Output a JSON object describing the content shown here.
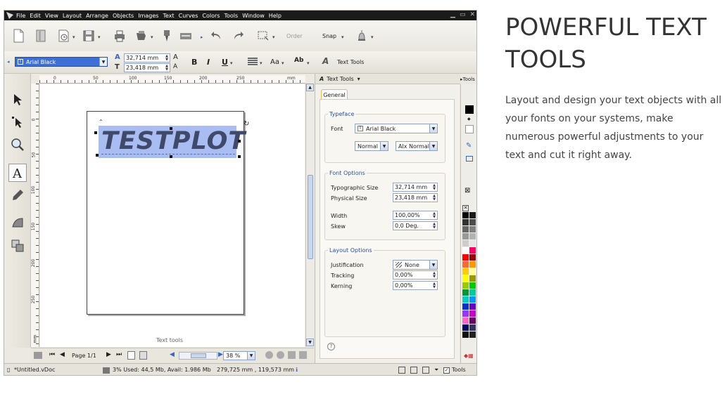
{
  "window": {
    "menu": [
      "File",
      "Edit",
      "View",
      "Layout",
      "Arrange",
      "Objects",
      "Images",
      "Text",
      "Curves",
      "Colors",
      "Tools",
      "Window",
      "Help"
    ]
  },
  "toolbar": {
    "order_label": "Order",
    "snap_label": "Snap"
  },
  "text_toolbar": {
    "font_name": "Arial Black",
    "typographic_size": "32,714 mm",
    "physical_size": "23,418 mm",
    "bold_label": "B",
    "italic_label": "I",
    "underline_label": "U",
    "case_label": "Aa",
    "text_tools_label": "Text Tools"
  },
  "ruler": {
    "top_ticks": [
      "0",
      "50",
      "100",
      "150",
      "200",
      "250",
      "mm"
    ],
    "left_ticks": [
      "0",
      "50",
      "100",
      "150",
      "200",
      "250",
      "mm"
    ]
  },
  "canvas": {
    "text_object": "TESTPLOT",
    "caption": "Text tools"
  },
  "navigation": {
    "page_label": "Page 1/1",
    "zoom": "38 %"
  },
  "status": {
    "document": "*Untitled.vDoc",
    "memory": "3%  Used: 44,5 Mb, Avail: 1.986 Mb",
    "coordinates": "279,725 mm , 119,573 mm",
    "tools_label": "Tools"
  },
  "docker": {
    "title": "Text Tools",
    "tools_tab": "Tools",
    "tab_general": "General",
    "typeface": {
      "group_title": "Typeface",
      "font_label": "Font",
      "font_value": "Arial Black",
      "style_value": "Normal",
      "alt_value": "Alx Normal"
    },
    "font_options": {
      "group_title": "Font Options",
      "typographic_size_label": "Typographic Size",
      "typographic_size_value": "32,714 mm",
      "physical_size_label": "Physical Size",
      "physical_size_value": "23,418 mm",
      "width_label": "Width",
      "width_value": "100,00%",
      "skew_label": "Skew",
      "skew_value": "0,0 Deg."
    },
    "layout_options": {
      "group_title": "Layout Options",
      "justification_label": "Justification",
      "justification_value": "None",
      "tracking_label": "Tracking",
      "tracking_value": "0,00%",
      "kerning_label": "Kerning",
      "kerning_value": "0,00%"
    },
    "help_icon_label": "?"
  },
  "palette": {
    "colors": [
      "#000000",
      "#1a1a1a",
      "#333333",
      "#4d4d4d",
      "#666666",
      "#808080",
      "#999999",
      "#b3b3b3",
      "#cccccc",
      "#e6e6e6",
      "#ffffff",
      "#ff0066",
      "#ff0000",
      "#990000",
      "#ff6633",
      "#ff9900",
      "#ffcc00",
      "#ffff99",
      "#ffff00",
      "#999900",
      "#99cc00",
      "#00cc00",
      "#009933",
      "#00cc99",
      "#00cccc",
      "#0099ff",
      "#0033cc",
      "#6600cc",
      "#9933ff",
      "#cc00cc",
      "#ff66cc",
      "#660066",
      "#000066",
      "#333366",
      "#111111",
      "#222222"
    ]
  },
  "marketing": {
    "title": "POWERFUL TEXT TOOLS",
    "description": "Layout and design your text objects with all your fonts on your systems, make numerous powerful adjustments to your text and cut it right away."
  }
}
